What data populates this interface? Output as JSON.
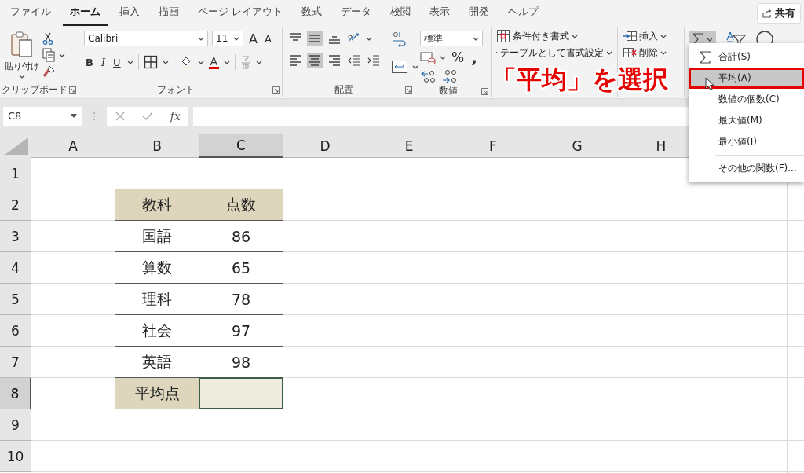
{
  "tabs": [
    {
      "label": "ファイル",
      "selected": false
    },
    {
      "label": "ホーム",
      "selected": true
    },
    {
      "label": "挿入",
      "selected": false
    },
    {
      "label": "描画",
      "selected": false
    },
    {
      "label": "ページ レイアウト",
      "selected": false
    },
    {
      "label": "数式",
      "selected": false
    },
    {
      "label": "データ",
      "selected": false
    },
    {
      "label": "校閲",
      "selected": false
    },
    {
      "label": "表示",
      "selected": false
    },
    {
      "label": "開発",
      "selected": false
    },
    {
      "label": "ヘルプ",
      "selected": false
    }
  ],
  "share_button": "共有",
  "clipboard": {
    "paste": "貼り付け",
    "label": "クリップボード"
  },
  "font": {
    "name": "Calibri",
    "size": "11",
    "grow": "A",
    "shrink": "A",
    "styles": [
      "B",
      "I",
      "U"
    ],
    "color_letter": "A",
    "label": "フォント"
  },
  "alignment": {
    "label": "配置",
    "buttons": [
      {
        "kind": "top",
        "selected": false
      },
      {
        "kind": "middle",
        "selected": true
      },
      {
        "kind": "bottom",
        "selected": false
      },
      {
        "kind": "left",
        "selected": false
      },
      {
        "kind": "center",
        "selected": true
      },
      {
        "kind": "right",
        "selected": false
      }
    ]
  },
  "number": {
    "format": "標準",
    "percent": "%",
    "comma": ",",
    "label": "数値"
  },
  "styles": [
    "条件付き書式",
    "テーブルとして書式設定"
  ],
  "cells": [
    "挿入",
    "削除"
  ],
  "annotation": "「平均」を選択",
  "autosum_menu": [
    {
      "label": "合計(S)",
      "kind": "sum",
      "selected": false
    },
    {
      "label": "平均(A)",
      "kind": "plain",
      "selected": true
    },
    {
      "label": "数値の個数(C)",
      "kind": "plain",
      "selected": false
    },
    {
      "label": "最大値(M)",
      "kind": "plain",
      "selected": false
    },
    {
      "label": "最小値(I)",
      "kind": "plain",
      "selected": false
    },
    {
      "label": "その他の関数(F)...",
      "kind": "more",
      "selected": false
    }
  ],
  "formula_bar": {
    "name_box": "C8",
    "function_label": "fx"
  },
  "columns": [
    {
      "label": "A",
      "selected": false
    },
    {
      "label": "B",
      "selected": false
    },
    {
      "label": "C",
      "selected": true
    },
    {
      "label": "D",
      "selected": false
    },
    {
      "label": "E",
      "selected": false
    },
    {
      "label": "F",
      "selected": false
    },
    {
      "label": "G",
      "selected": false
    },
    {
      "label": "H",
      "selected": false
    }
  ],
  "row_numbers": [
    {
      "label": "1",
      "selected": false
    },
    {
      "label": "2",
      "selected": false
    },
    {
      "label": "3",
      "selected": false
    },
    {
      "label": "4",
      "selected": false
    },
    {
      "label": "5",
      "selected": false
    },
    {
      "label": "6",
      "selected": false
    },
    {
      "label": "7",
      "selected": false
    },
    {
      "label": "8",
      "selected": true
    },
    {
      "label": "9",
      "selected": false
    },
    {
      "label": "10",
      "selected": false
    }
  ],
  "table": {
    "header": [
      "教科",
      "点数"
    ],
    "rows": [
      [
        "国語",
        "86"
      ],
      [
        "算数",
        "65"
      ],
      [
        "理科",
        "78"
      ],
      [
        "社会",
        "97"
      ],
      [
        "英語",
        "98"
      ]
    ],
    "footer": {
      "label": "平均点",
      "selected": true
    }
  }
}
